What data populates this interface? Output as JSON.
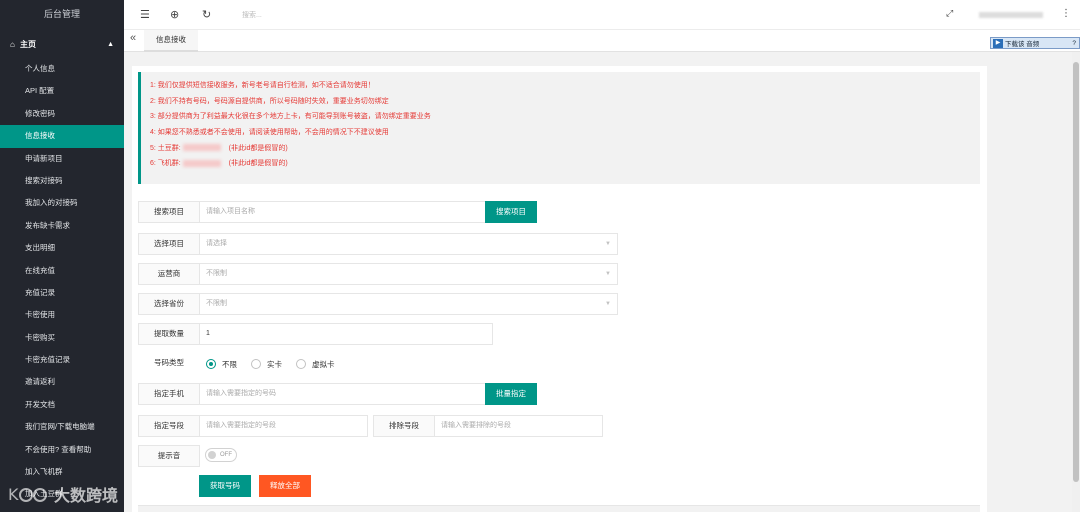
{
  "sidebar": {
    "app_title": "后台管理",
    "home_label": "主页",
    "items": [
      {
        "label": "个人信息"
      },
      {
        "label": "API 配置"
      },
      {
        "label": "修改密码"
      },
      {
        "label": "信息接收",
        "active": true
      },
      {
        "label": "申请新项目"
      },
      {
        "label": "搜索对接码"
      },
      {
        "label": "我加入的对接码"
      },
      {
        "label": "发布缺卡需求"
      },
      {
        "label": "支出明细"
      },
      {
        "label": "在线充值"
      },
      {
        "label": "充值记录"
      },
      {
        "label": "卡密使用"
      },
      {
        "label": "卡密购买"
      },
      {
        "label": "卡密充值记录"
      },
      {
        "label": "邀请返利"
      },
      {
        "label": "开发文档"
      },
      {
        "label": "我们官网/下载电脑端"
      },
      {
        "label": "不会使用? 查看帮助"
      },
      {
        "label": "加入飞机群"
      },
      {
        "label": "加入土豆群"
      }
    ],
    "watermark": "大数跨境"
  },
  "topbar": {
    "search_placeholder": "搜索...",
    "icons": [
      "menu-fold-icon",
      "globe-icon",
      "refresh-icon",
      "fullscreen-icon",
      "more-icon"
    ]
  },
  "tabs": {
    "current": "信息接收"
  },
  "browser_toolbar": {
    "label": "下载该 音频",
    "help": "?"
  },
  "notice": {
    "lines": [
      "1: 我们仅提供短信接收服务，新号老号请自行检测，如不适合请勿使用！",
      "2: 我们不持有号码，号码源自提供商，所以号码随时失效，重要业务切勿绑定",
      "3: 部分提供商为了利益最大化很在多个地方上卡，有可能导到账号被盗，请勿绑定重要业务",
      "4: 如果您不熟悉或者不会使用，请阅读使用帮助，不会用的情况下不建议使用",
      "5: 土豆群:",
      "6: 飞机群:"
    ],
    "group_note": "(非此id都是假冒的)"
  },
  "form": {
    "search_project": {
      "label": "搜索项目",
      "placeholder": "请输入项目名称",
      "button": "搜索项目"
    },
    "select_project": {
      "label": "选择项目",
      "value": "请选择"
    },
    "carrier": {
      "label": "运营商",
      "value": "不限制"
    },
    "province": {
      "label": "选择省份",
      "value": "不限制"
    },
    "quantity": {
      "label": "提取数量",
      "value": "1"
    },
    "number_type": {
      "label": "号码类型",
      "options": [
        "不限",
        "实卡",
        "虚拟卡"
      ],
      "selected": "不限"
    },
    "assign_phone": {
      "label": "指定手机",
      "placeholder": "请输入需要指定的号码",
      "button": "批量指定"
    },
    "assign_segment": {
      "label": "指定号段",
      "placeholder": "请输入需要指定的号段"
    },
    "exclude_segment": {
      "label": "排除号段",
      "placeholder": "请输入需要排除的号段"
    },
    "alert_sound": {
      "label": "提示音",
      "state": "OFF"
    },
    "get_number_button": "获取号码",
    "release_all_button": "释放全部"
  }
}
